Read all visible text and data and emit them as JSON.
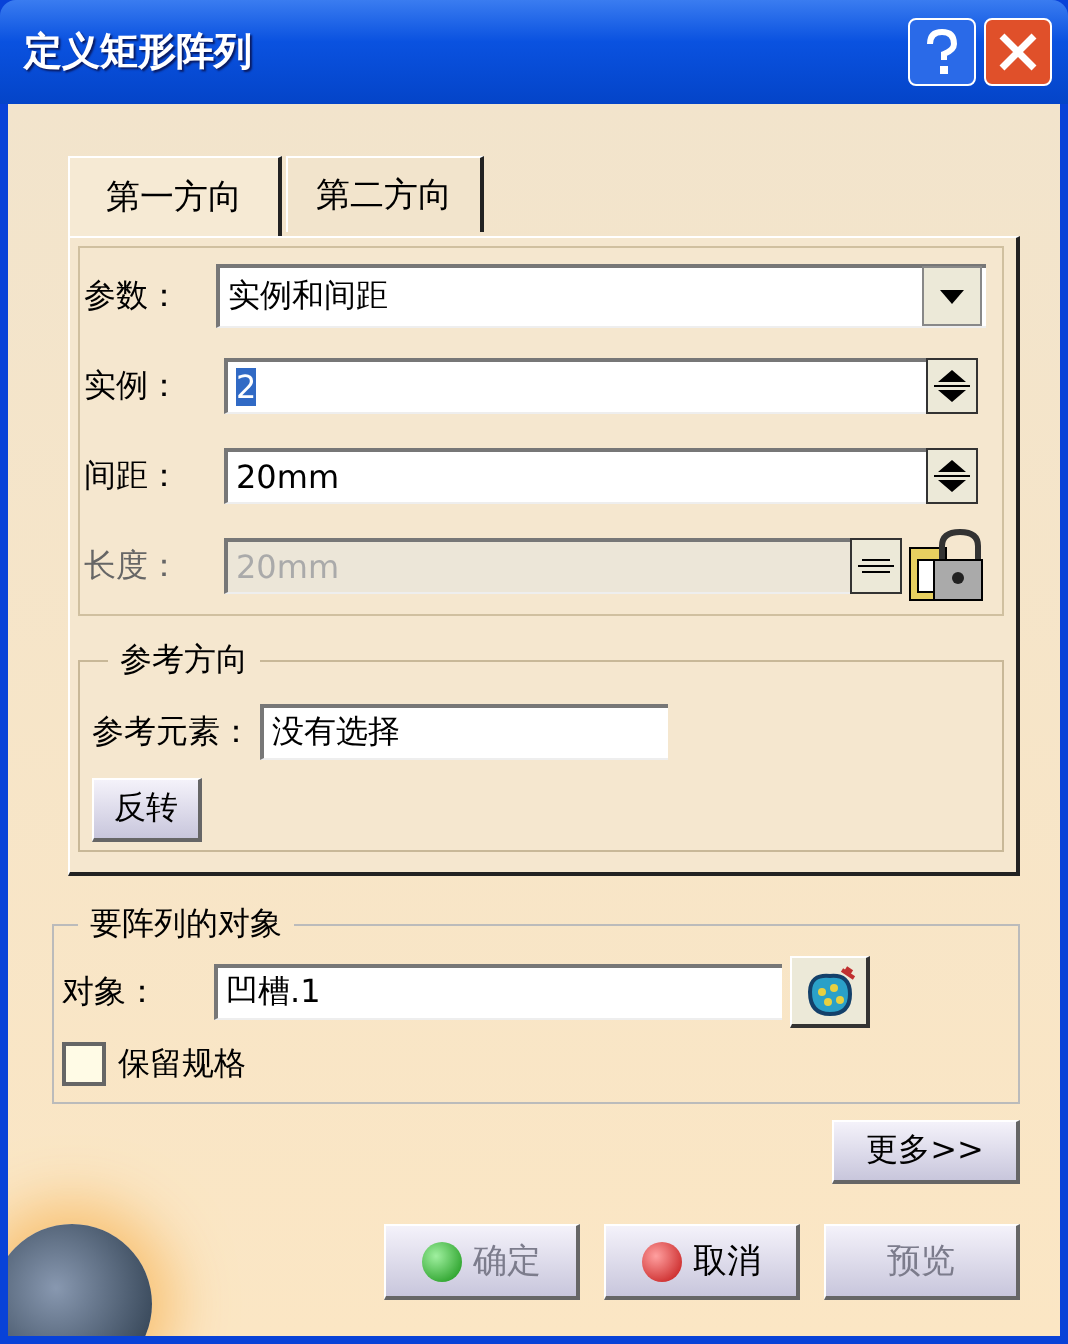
{
  "window": {
    "title": "定义矩形阵列"
  },
  "tabs": [
    {
      "label": "第一方向",
      "selected": true
    },
    {
      "label": "第二方向",
      "selected": false
    }
  ],
  "parameters": [
    {
      "label": "参数：",
      "kind": "combo",
      "value": "实例和间距",
      "disabled": false,
      "highlighted": false
    },
    {
      "label": "实例：",
      "kind": "spin",
      "value": "2",
      "disabled": false,
      "highlighted": true
    },
    {
      "label": "间距：",
      "kind": "spin",
      "value": "20mm",
      "disabled": false,
      "highlighted": false
    },
    {
      "label": "长度：",
      "kind": "spin_locked",
      "value": "20mm",
      "disabled": true,
      "highlighted": false
    }
  ],
  "reference_direction": {
    "title": "参考方向",
    "element_label": "参考元素：",
    "element_value": "没有选择",
    "reverse_button": "反转"
  },
  "objects_group": {
    "title": "要阵列的对象",
    "object_label": "对象：",
    "object_value": "凹槽.1",
    "keep_spec": {
      "label": "保留规格",
      "checked": false
    }
  },
  "more_button": "更多>>",
  "buttons": [
    {
      "label": "确定",
      "kind": "ok",
      "disabled": true
    },
    {
      "label": "取消",
      "kind": "cancel",
      "disabled": false
    },
    {
      "label": "预览",
      "kind": "plain",
      "disabled": true
    }
  ]
}
